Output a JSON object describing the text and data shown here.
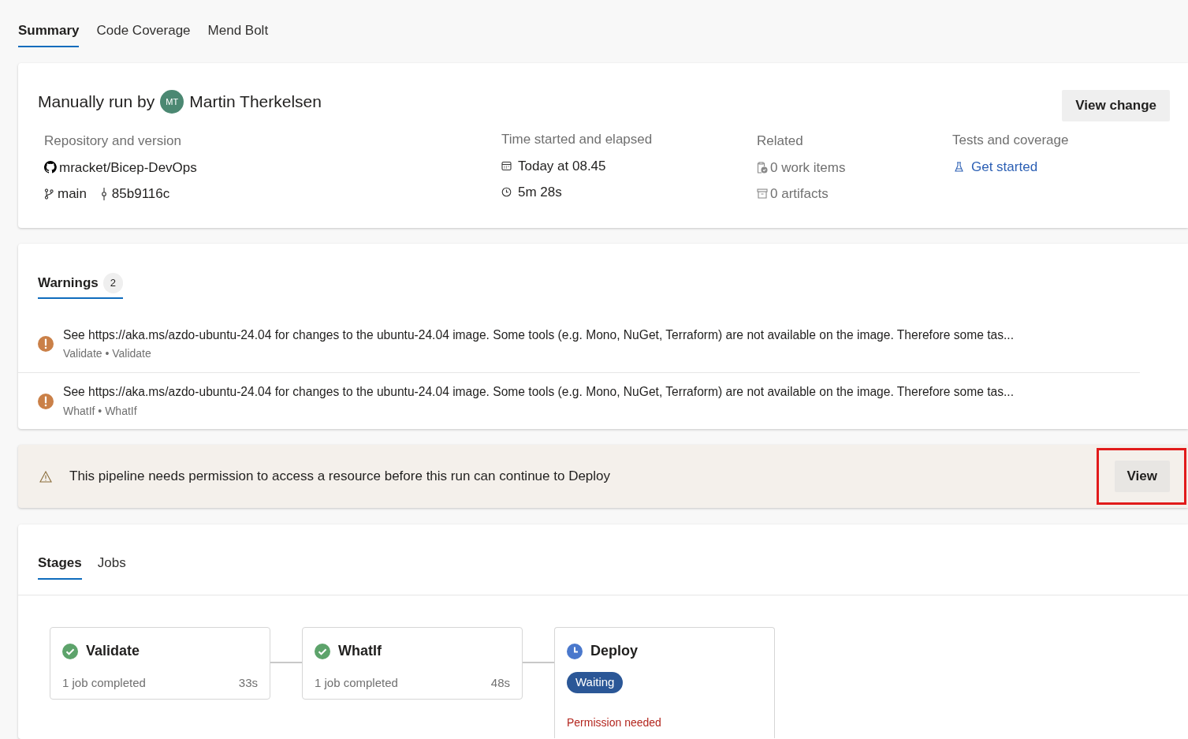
{
  "tabs": [
    {
      "label": "Summary",
      "selected": true
    },
    {
      "label": "Code Coverage",
      "selected": false
    },
    {
      "label": "Mend Bolt",
      "selected": false
    }
  ],
  "run": {
    "prefix": "Manually run by",
    "avatar_initials": "MT",
    "user": "Martin Therkelsen",
    "view_change": "View change",
    "repository": {
      "heading": "Repository and version",
      "repo": "mracket/Bicep-DevOps",
      "branch": "main",
      "commit": "85b9116c"
    },
    "time": {
      "heading": "Time started and elapsed",
      "started": "Today at 08.45",
      "elapsed": "5m 28s"
    },
    "related": {
      "heading": "Related",
      "work_items": "0 work items",
      "artifacts": "0 artifacts"
    },
    "tests": {
      "heading": "Tests and coverage",
      "link": "Get started"
    }
  },
  "warnings": {
    "tab": "Warnings",
    "count": "2",
    "items": [
      {
        "text": "See https://aka.ms/azdo-ubuntu-24.04 for changes to the ubuntu-24.04 image. Some tools (e.g. Mono, NuGet, Terraform) are not available on the image. Therefore some tas...",
        "source": "Validate • Validate"
      },
      {
        "text": "See https://aka.ms/azdo-ubuntu-24.04 for changes to the ubuntu-24.04 image. Some tools (e.g. Mono, NuGet, Terraform) are not available on the image. Therefore some tas...",
        "source": "WhatIf • WhatIf"
      }
    ]
  },
  "banner": {
    "message": "This pipeline needs permission to access a resource before this run can continue to Deploy",
    "button": "View",
    "highlighted": true
  },
  "stage_tabs": [
    {
      "label": "Stages",
      "selected": true
    },
    {
      "label": "Jobs",
      "selected": false
    }
  ],
  "stages": [
    {
      "name": "Validate",
      "kind": "succeeded",
      "summary": "1 job completed",
      "duration": "33s"
    },
    {
      "name": "WhatIf",
      "kind": "succeeded",
      "summary": "1 job completed",
      "duration": "48s"
    },
    {
      "name": "Deploy",
      "kind": "waiting",
      "badge": "Waiting",
      "note": "Permission needed"
    }
  ]
}
